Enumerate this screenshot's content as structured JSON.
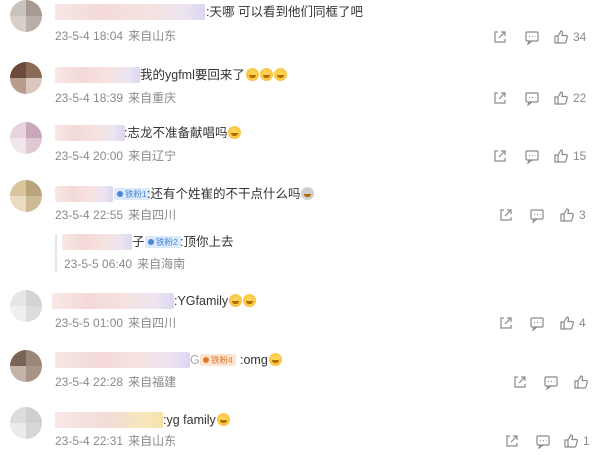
{
  "comments": [
    {
      "text_visible": ":天哪 可以看到他们同框了吧",
      "date": "23-5-4 18:04",
      "location": "来自山东",
      "like_count": "34",
      "avatar_colors": [
        "#c9c2bd",
        "#a89a92",
        "#d8cfc9",
        "#b9aea8"
      ]
    },
    {
      "text_visible": "我的ygfml要回来了",
      "emoji_count": 3,
      "date": "23-5-4 18:39",
      "location": "来自重庆",
      "like_count": "22",
      "avatar_colors": [
        "#6b4a3c",
        "#8c6a58",
        "#b89d8f",
        "#d9c7bd"
      ]
    },
    {
      "text_visible": ":志龙不准备献唱吗",
      "emoji_count": 1,
      "date": "23-5-4 20:00",
      "location": "来自辽宁",
      "like_count": "15",
      "avatar_colors": [
        "#e7d4de",
        "#c7a9b9",
        "#f0e6ea",
        "#ddc8d3"
      ]
    },
    {
      "text_visible": ":还有个姓崔的不干点什么吗",
      "badge": "铁粉1",
      "date": "23-5-4 22:55",
      "location": "来自四川",
      "like_count": "3",
      "avatar_colors": [
        "#d8c59c",
        "#b9a37a",
        "#e9dcc0",
        "#cdbb96"
      ],
      "reply": {
        "name_suffix": "子",
        "badge": "铁粉2",
        "text_visible": ":顶你上去",
        "date": "23-5-5 06:40",
        "location": "来自海南"
      }
    },
    {
      "text_visible": ":YGfamily",
      "emoji_count": 2,
      "date": "23-5-5 01:00",
      "location": "来自四川",
      "like_count": "4",
      "avatar_colors": [
        "#e5e5e5",
        "#d4d4d4",
        "#efefef",
        "#dcdcdc"
      ]
    },
    {
      "name_suffix": "G",
      "badge": "铁粉4",
      "text_visible": ":omg",
      "emoji_count": 1,
      "date": "23-5-4 22:28",
      "location": "来自福建",
      "like_count": "",
      "avatar_colors": [
        "#7a6357",
        "#9d8678",
        "#c4b3a8",
        "#a89387"
      ]
    },
    {
      "text_visible": ":yg family",
      "emoji_count": 1,
      "date": "23-5-4 22:31",
      "location": "来自山东",
      "like_count": "1",
      "avatar_colors": [
        "#dcdcdc",
        "#cfcfcf",
        "#ebebeb",
        "#d6d6d6"
      ]
    }
  ],
  "icons": {
    "share": "share-icon",
    "comment": "comment-icon",
    "like": "thumbs-up-icon"
  }
}
